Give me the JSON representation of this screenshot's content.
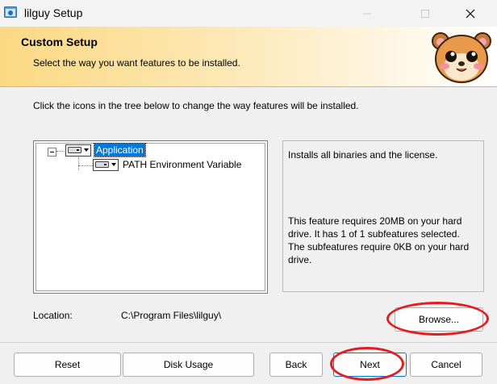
{
  "window": {
    "title": "lilguy Setup"
  },
  "banner": {
    "title": "Custom Setup",
    "subtitle": "Select the way you want features to be installed."
  },
  "instruction": "Click the icons in the tree below to change the way features will be installed.",
  "tree": {
    "items": [
      {
        "label": "Application",
        "selected": true,
        "icon": "drive-icon"
      },
      {
        "label": "PATH Environment Variable",
        "selected": false,
        "icon": "drive-icon"
      }
    ]
  },
  "description": {
    "summary": "Installs all binaries and the license.",
    "requirements": "This feature requires 20MB on your hard drive. It has 1 of 1 subfeatures selected. The subfeatures require 0KB on your hard drive."
  },
  "location": {
    "label": "Location:",
    "value": "C:\\Program Files\\lilguy\\"
  },
  "buttons": {
    "browse": "Browse...",
    "reset": "Reset",
    "disk_usage": "Disk Usage",
    "back": "Back",
    "next": "Next",
    "cancel": "Cancel"
  },
  "colors": {
    "selection": "#0078d7",
    "annotation_circle": "#e02020",
    "banner_gradient_start": "#fbd983"
  }
}
